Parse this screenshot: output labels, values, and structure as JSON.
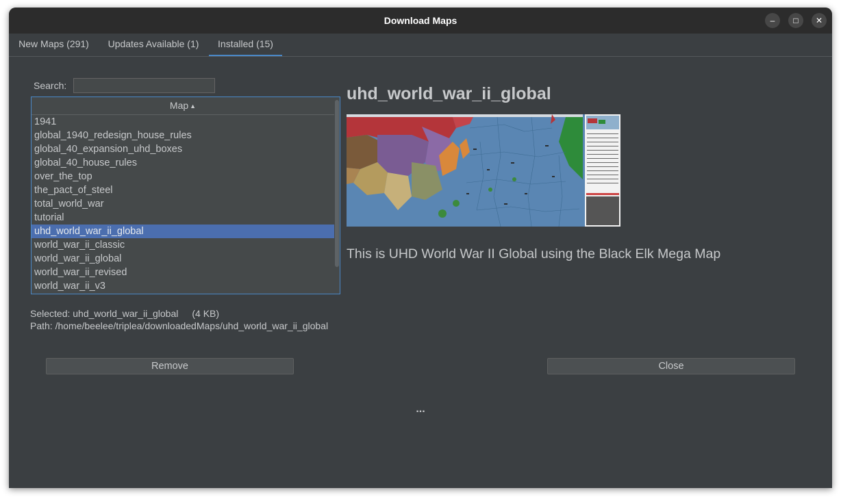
{
  "window": {
    "title": "Download Maps",
    "controls": {
      "minimize_icon": "–",
      "maximize_icon": "□",
      "close_icon": "✕"
    }
  },
  "tabs": [
    {
      "label": "New Maps (291)",
      "active": false
    },
    {
      "label": "Updates Available (1)",
      "active": false
    },
    {
      "label": "Installed (15)",
      "active": true
    }
  ],
  "search": {
    "label": "Search:",
    "value": ""
  },
  "map_list": {
    "header": "Map",
    "sort": "ascending",
    "items": [
      "1941",
      "global_1940_redesign_house_rules",
      "global_40_expansion_uhd_boxes",
      "global_40_house_rules",
      "over_the_top",
      "the_pact_of_steel",
      "total_world_war",
      "tutorial",
      "uhd_world_war_ii_global",
      "world_war_ii_classic",
      "world_war_ii_global",
      "world_war_ii_revised",
      "world_war_ii_v3"
    ],
    "selected_index": 8
  },
  "details": {
    "title": "uhd_world_war_ii_global",
    "description": "This is UHD World War II Global using the Black Elk Mega Map"
  },
  "selection_info": {
    "selected_label": "Selected: uhd_world_war_ii_global",
    "size": "(4 KB)",
    "path": "Path: /home/beelee/triplea/downloadedMaps/uhd_world_war_ii_global"
  },
  "buttons": {
    "remove": "Remove",
    "close": "Close"
  },
  "status": "...",
  "colors": {
    "window_bg": "#3b3f42",
    "titlebar_bg": "#2c2c2c",
    "accent": "#4a88c7",
    "selection": "#4b6eaf",
    "text": "#c7c9cb"
  }
}
